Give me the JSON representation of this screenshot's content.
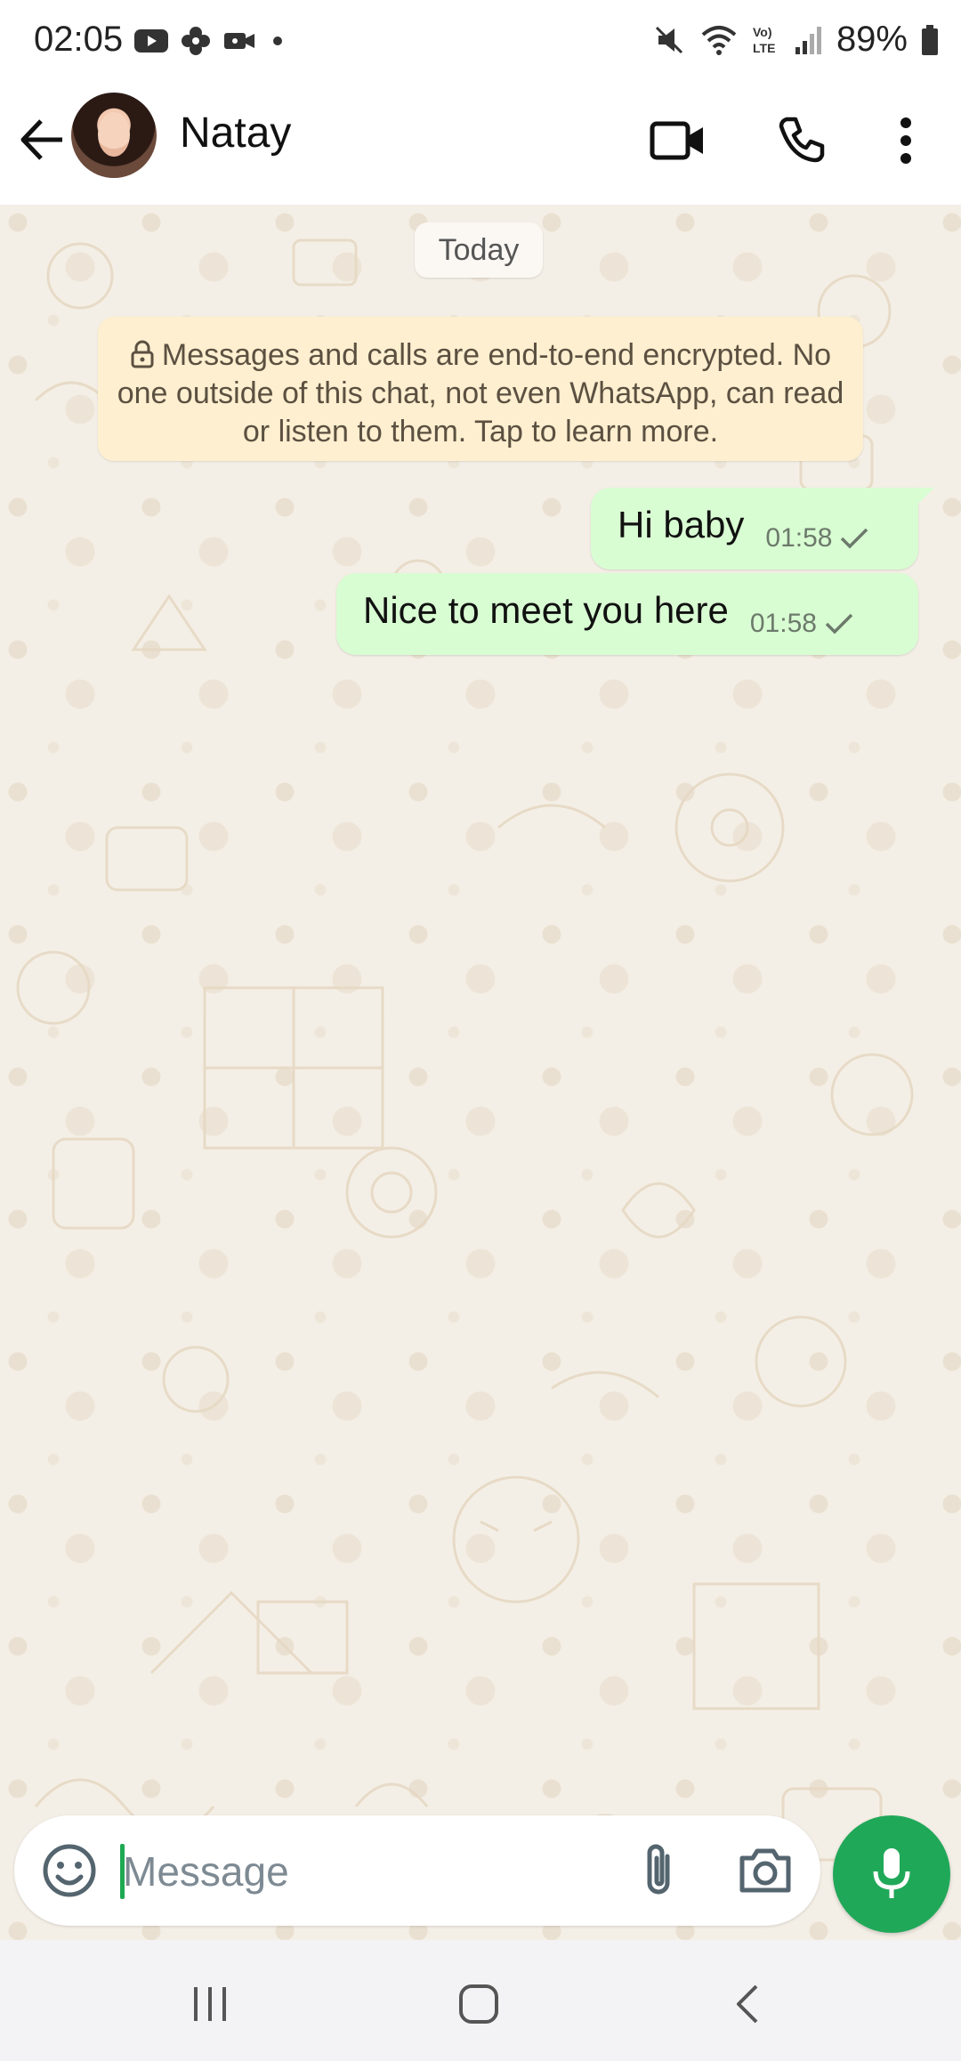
{
  "status_bar": {
    "time": "02:05",
    "battery": "89%",
    "left_icons": [
      "youtube-icon",
      "pinwheel-icon",
      "video-record-icon",
      "dot-icon"
    ],
    "right_icons": [
      "mute-icon",
      "wifi-icon",
      "volte-icon",
      "signal-icon",
      "battery-icon"
    ]
  },
  "header": {
    "contact_name": "Natay",
    "icons": [
      "back-arrow-icon",
      "video-call-icon",
      "phone-call-icon",
      "more-options-icon"
    ]
  },
  "chat": {
    "date_label": "Today",
    "encryption_notice": "Messages and calls are end-to-end encrypted. No one outside of this chat, not even WhatsApp, can read or listen to them. Tap to learn more.",
    "messages": [
      {
        "text": "Hi baby",
        "time": "01:58",
        "status": "sent"
      },
      {
        "text": "Nice to meet you here",
        "time": "01:58",
        "status": "sent"
      }
    ]
  },
  "composer": {
    "placeholder": "Message",
    "value": "",
    "icons": [
      "emoji-icon",
      "paperclip-icon",
      "camera-icon",
      "microphone-icon"
    ]
  },
  "navigation": {
    "buttons": [
      "recent-apps-icon",
      "home-icon",
      "back-icon"
    ]
  },
  "colors": {
    "bubble_out": "#d9fdd3",
    "notice_bg": "#fdefcf",
    "chat_bg": "#f4efe6",
    "accent": "#20a859"
  }
}
